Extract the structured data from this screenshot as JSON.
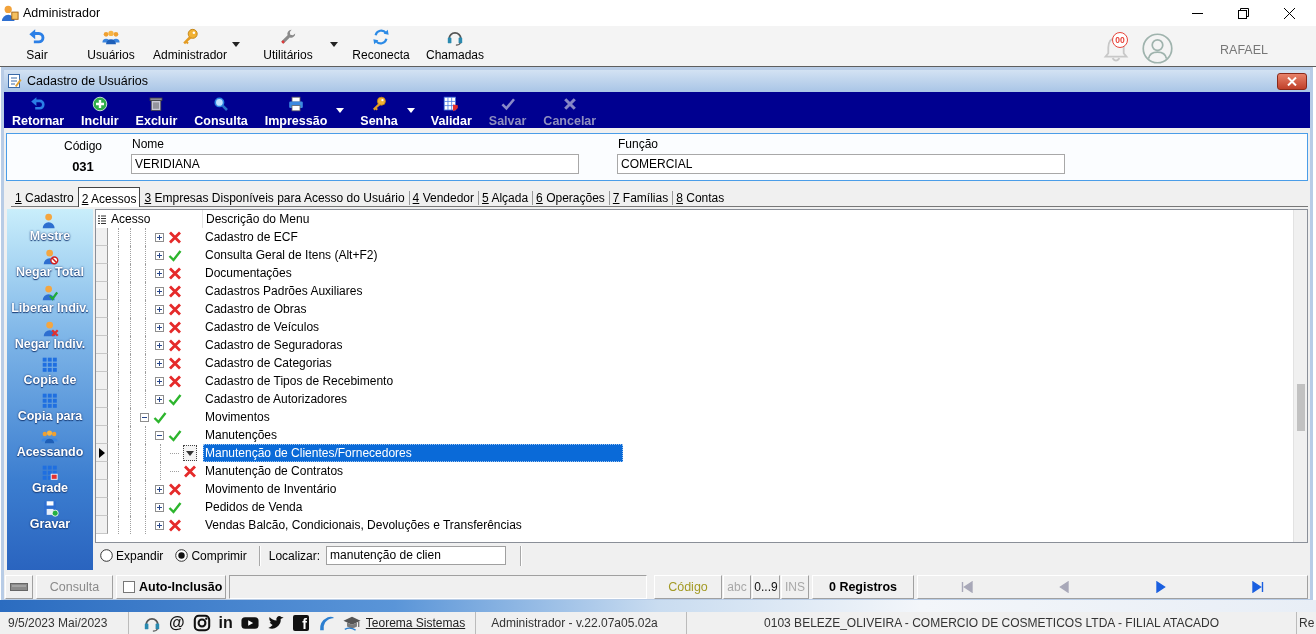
{
  "window": {
    "title": "Administrador"
  },
  "main_toolbar": {
    "items": [
      {
        "label": "Sair",
        "dropdown": false
      },
      {
        "label": "Usuários",
        "dropdown": false
      },
      {
        "label": "Administrador",
        "dropdown": true
      },
      {
        "label": "Utilitários",
        "dropdown": true
      },
      {
        "label": "Reconecta",
        "dropdown": false
      },
      {
        "label": "Chamadas",
        "dropdown": false
      }
    ],
    "notification_count": "00",
    "user": "RAFAEL"
  },
  "form_window": {
    "title": "Cadastro de Usuários"
  },
  "toolbar": [
    {
      "label": "Retornar",
      "disabled": false,
      "dropdown": false
    },
    {
      "label": "Incluir",
      "disabled": false,
      "dropdown": false
    },
    {
      "label": "Excluir",
      "disabled": false,
      "dropdown": false
    },
    {
      "label": "Consulta",
      "disabled": false,
      "dropdown": false
    },
    {
      "label": "Impressão",
      "disabled": false,
      "dropdown": true
    },
    {
      "label": "Senha",
      "disabled": false,
      "dropdown": true
    },
    {
      "label": "Validar",
      "disabled": false,
      "dropdown": false
    },
    {
      "label": "Salvar",
      "disabled": true,
      "dropdown": false
    },
    {
      "label": "Cancelar",
      "disabled": true,
      "dropdown": false
    }
  ],
  "header": {
    "code_label": "Código",
    "code": "031",
    "name_label": "Nome",
    "name": "VERIDIANA",
    "role_label": "Função",
    "role": "COMERCIAL"
  },
  "tabs": [
    {
      "key": "1",
      "label": "Cadastro",
      "selected": false
    },
    {
      "key": "2",
      "label": "Acessos",
      "selected": true
    },
    {
      "key": "3",
      "label": "Empresas Disponíveis para Acesso do Usuário",
      "selected": false
    },
    {
      "key": "4",
      "label": "Vendedor",
      "selected": false
    },
    {
      "key": "5",
      "label": "Alçada",
      "selected": false
    },
    {
      "key": "6",
      "label": "Operações",
      "selected": false
    },
    {
      "key": "7",
      "label": "Famílias",
      "selected": false
    },
    {
      "key": "8",
      "label": "Contas",
      "selected": false
    }
  ],
  "side_actions": [
    {
      "label": "Mestre"
    },
    {
      "label": "Negar Total"
    },
    {
      "label": "Liberar Indiv."
    },
    {
      "label": "Negar Indiv."
    },
    {
      "label": "Copia de"
    },
    {
      "label": "Copia para"
    },
    {
      "label": "Acessando"
    },
    {
      "label": "Grade"
    },
    {
      "label": "Gravar"
    }
  ],
  "tree": {
    "columns": [
      "Acesso",
      "Descrição do Menu"
    ],
    "nodes": [
      {
        "children": [
          {
            "label": "Cadastro de ECF",
            "access": false,
            "expanded": false,
            "editing": false,
            "selected": false
          },
          {
            "label": "Consulta Geral de Itens (Alt+F2)",
            "access": true,
            "expanded": false,
            "editing": false,
            "selected": false
          },
          {
            "label": "Documentações",
            "access": false,
            "expanded": false,
            "editing": false,
            "selected": false
          },
          {
            "label": "Cadastros Padrões Auxiliares",
            "access": false,
            "expanded": false,
            "editing": false,
            "selected": false
          },
          {
            "label": "Cadastro de Obras",
            "access": false,
            "expanded": false,
            "editing": false,
            "selected": false
          },
          {
            "label": "Cadastro de Veículos",
            "access": false,
            "expanded": false,
            "editing": false,
            "selected": false
          },
          {
            "label": "Cadastro de Seguradoras",
            "access": false,
            "expanded": false,
            "editing": false,
            "selected": false
          },
          {
            "label": "Cadastro de Categorias",
            "access": false,
            "expanded": false,
            "editing": false,
            "selected": false
          },
          {
            "label": "Cadastro de Tipos de Recebimento",
            "access": false,
            "expanded": false,
            "editing": false,
            "selected": false
          },
          {
            "label": "Cadastro de Autorizadores",
            "access": true,
            "expanded": false,
            "editing": false,
            "selected": false
          }
        ]
      },
      {
        "label": "Movimentos",
        "access": true,
        "expanded": true,
        "editing": false,
        "selected": false,
        "children": [
          {
            "label": "Manutenções",
            "access": true,
            "expanded": true,
            "editing": false,
            "selected": false,
            "children": [
              {
                "label": "Manutenção de Clientes/Fornecedores",
                "editing": true,
                "selected": true
              },
              {
                "label": "Manutenção de Contratos",
                "access": false,
                "editing": false,
                "selected": false
              }
            ]
          },
          {
            "label": "Movimento de Inventário",
            "access": false,
            "expanded": false,
            "editing": false,
            "selected": false
          },
          {
            "label": "Pedidos de Venda",
            "access": true,
            "expanded": false,
            "editing": false,
            "selected": false
          },
          {
            "label": "Vendas Balcão, Condicionais, Devoluções e Transferências",
            "access": false,
            "expanded": false,
            "editing": false,
            "selected": false
          }
        ]
      }
    ]
  },
  "tree_options": {
    "modes": [
      {
        "label": "Expandir",
        "selected": false
      },
      {
        "label": "Comprimir",
        "selected": true
      }
    ],
    "search_label": "Localizar:",
    "search_value": "manutenção de clien"
  },
  "status_bar": {
    "mode": "Consulta",
    "auto_include": {
      "label": "Auto-Inclusão",
      "checked": false
    },
    "sort_field": "Código",
    "toggles": [
      {
        "label": "abc",
        "on": false
      },
      {
        "label": "0...9",
        "on": true
      },
      {
        "label": "INS",
        "on": false
      }
    ],
    "records": "0 Registros",
    "nav": [
      {
        "kind": "first",
        "disabled": true
      },
      {
        "kind": "prev",
        "disabled": true
      },
      {
        "kind": "next",
        "disabled": false
      },
      {
        "kind": "last",
        "disabled": false
      }
    ]
  },
  "footer": {
    "date": "9/5/2023 Mai/2023",
    "social": [
      {
        "kind": "headset"
      },
      {
        "kind": "text",
        "text": "@"
      },
      {
        "kind": "camera"
      },
      {
        "kind": "text",
        "text": "in"
      },
      {
        "kind": "play"
      },
      {
        "kind": "bird"
      },
      {
        "kind": "tile",
        "text": "f"
      },
      {
        "kind": "swoosh"
      }
    ],
    "company_link": "Teorema Sistemas",
    "version": "Administrador - v.22.07a05.02a",
    "branch": "0103 BELEZE_OLIVEIRA - COMERCIO DE COSMETICOS LTDA - FILIAL ATACADO",
    "extra": "Re"
  }
}
